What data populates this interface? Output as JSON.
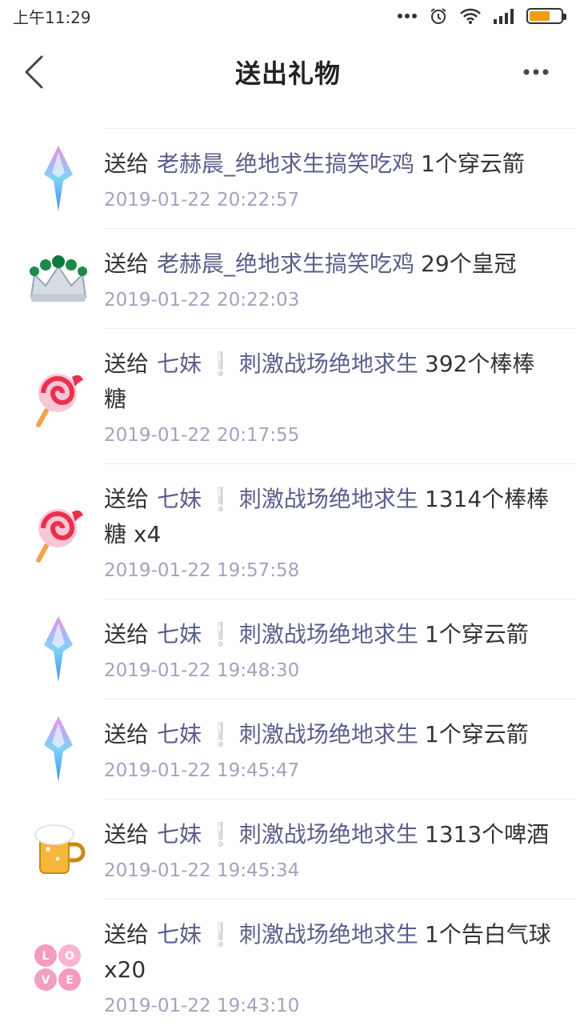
{
  "status_bar": {
    "time": "上午11:29",
    "icons": [
      "more-dots-icon",
      "alarm-icon",
      "wifi-icon",
      "signal-icon",
      "battery-icon"
    ]
  },
  "header": {
    "title": "送出礼物",
    "back_icon": "back-arrow-icon",
    "more_icon": "more-dots-icon"
  },
  "records": [
    {
      "icon": "rocket-gift-icon",
      "prefix": "送给",
      "recipient": "老赫晨_绝地求生搞笑吃鸡",
      "exclaim": "",
      "recipient_suffix": "",
      "gift": "1个穿云箭",
      "time": "2019-01-22 20:22:57"
    },
    {
      "icon": "crown-gift-icon",
      "prefix": "送给",
      "recipient": "老赫晨_绝地求生搞笑吃鸡",
      "exclaim": "",
      "recipient_suffix": "",
      "gift": "29个皇冠",
      "time": "2019-01-22 20:22:03"
    },
    {
      "icon": "lollipop-gift-icon",
      "prefix": "送给",
      "recipient": "七妹",
      "exclaim": "❕",
      "recipient_suffix": "刺激战场绝地求生",
      "gift": "392个棒棒糖",
      "time": "2019-01-22 20:17:55"
    },
    {
      "icon": "lollipop-gift-icon",
      "prefix": "送给",
      "recipient": "七妹",
      "exclaim": "❕",
      "recipient_suffix": "刺激战场绝地求生",
      "gift": "1314个棒棒糖 x4",
      "time": "2019-01-22 19:57:58"
    },
    {
      "icon": "rocket-gift-icon",
      "prefix": "送给",
      "recipient": "七妹",
      "exclaim": "❕",
      "recipient_suffix": "刺激战场绝地求生",
      "gift": "1个穿云箭",
      "time": "2019-01-22 19:48:30"
    },
    {
      "icon": "rocket-gift-icon",
      "prefix": "送给",
      "recipient": "七妹",
      "exclaim": "❕",
      "recipient_suffix": "刺激战场绝地求生",
      "gift": "1个穿云箭",
      "time": "2019-01-22 19:45:47"
    },
    {
      "icon": "beer-gift-icon",
      "prefix": "送给",
      "recipient": "七妹",
      "exclaim": "❕",
      "recipient_suffix": "刺激战场绝地求生",
      "gift": "1313个啤酒",
      "time": "2019-01-22 19:45:34"
    },
    {
      "icon": "love-balloon-gift-icon",
      "prefix": "送给",
      "recipient": "七妹",
      "exclaim": "❕",
      "recipient_suffix": "刺激战场绝地求生",
      "gift": "1个告白气球 x20",
      "time": "2019-01-22 19:43:10"
    }
  ]
}
